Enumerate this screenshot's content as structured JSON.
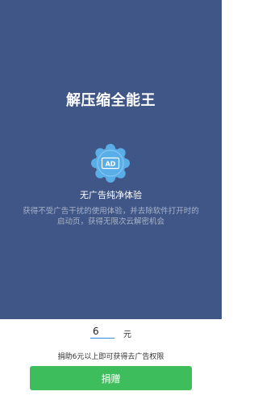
{
  "header": {
    "app_title": "解压缩全能王"
  },
  "feature": {
    "badge_text": "AD",
    "title": "无广告纯净体验",
    "description": "获得不受广告干扰的使用体验，并去除软件打开时的启动页，获得无限次云解密机会"
  },
  "donation": {
    "amount_value": "6",
    "unit": "元",
    "hint": "捐助6元以上即可获得去广告权限",
    "button_label": "捐赠"
  },
  "colors": {
    "panel_bg": "#3f5686",
    "button_bg": "#3dbd5b",
    "badge_bg": "#5aaee8",
    "input_underline": "#2c8be0"
  }
}
